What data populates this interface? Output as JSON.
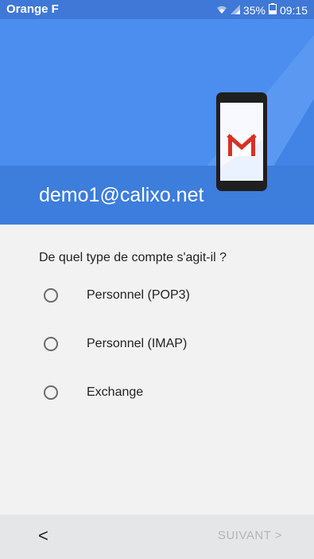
{
  "status_bar": {
    "carrier": "Orange F",
    "battery": "35%",
    "time": "09:15"
  },
  "header": {
    "email": "demo1@calixo.net",
    "illustration": "gmail-phone-icon"
  },
  "question": "De quel type de compte s'agit-il ?",
  "options": [
    {
      "label": "Personnel (POP3)",
      "selected": false
    },
    {
      "label": "Personnel (IMAP)",
      "selected": false
    },
    {
      "label": "Exchange",
      "selected": false
    }
  ],
  "nav": {
    "back_label": "<",
    "next_label": "SUIVANT >"
  },
  "colors": {
    "header_bg": "#4b8ef0",
    "email_band": "#3d7ddb",
    "status_bar": "#3f78d6",
    "next_disabled": "#b5b5b5"
  }
}
